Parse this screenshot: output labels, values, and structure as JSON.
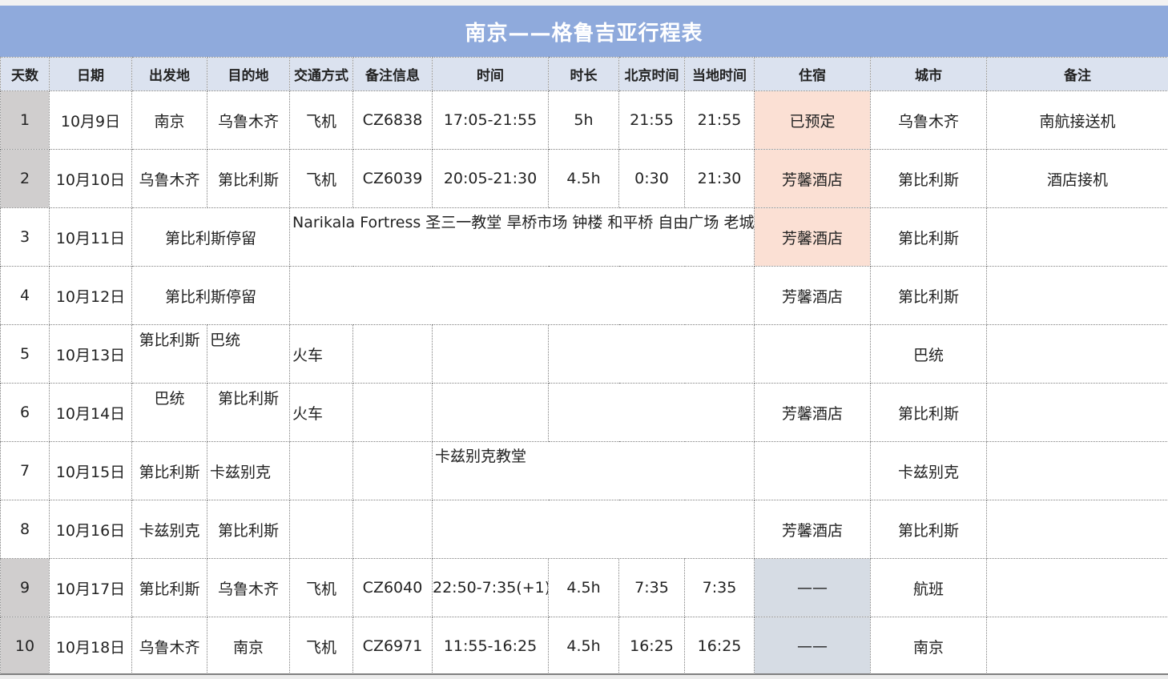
{
  "title": "南京——格鲁吉亚行程表",
  "headers": [
    "天数",
    "日期",
    "出发地",
    "目的地",
    "交通方式",
    "备注信息",
    "时间",
    "时长",
    "北京时间",
    "当地时间",
    "住宿",
    "城市",
    "备注"
  ],
  "rows": [
    {
      "day": "1",
      "date": "10月9日",
      "from": "南京",
      "to": "乌鲁木齐",
      "transport": "飞机",
      "info": "CZ6838",
      "time": "17:05-21:55",
      "duration": "5h",
      "beijing": "21:55",
      "local": "21:55",
      "hotel": "已预定",
      "city": "乌鲁木齐",
      "note": "南航接送机"
    },
    {
      "day": "2",
      "date": "10月10日",
      "from": "乌鲁木齐",
      "to": "第比利斯",
      "transport": "飞机",
      "info": "CZ6039",
      "time": "20:05-21:30",
      "duration": "4.5h",
      "beijing": "0:30",
      "local": "21:30",
      "hotel": "芳馨酒店",
      "city": "第比利斯",
      "note": "酒店接机"
    },
    {
      "day": "3",
      "date": "10月11日",
      "stay": "第比利斯停留",
      "activity": "Narikala Fortress 圣三一教堂 旱桥市场 钟楼 和平桥 自由广场 老城",
      "hotel": "芳馨酒店",
      "city": "第比利斯",
      "note": ""
    },
    {
      "day": "4",
      "date": "10月12日",
      "stay": "第比利斯停留",
      "activity": "",
      "hotel": "芳馨酒店",
      "city": "第比利斯",
      "note": ""
    },
    {
      "day": "5",
      "date": "10月13日",
      "from": "第比利斯",
      "to": "巴统",
      "transport": "火车",
      "info": "",
      "time": "",
      "duration": "",
      "beijing": "",
      "local": "",
      "hotel": "",
      "city": "巴统",
      "note": ""
    },
    {
      "day": "6",
      "date": "10月14日",
      "from": "巴统",
      "to": "第比利斯",
      "transport": "火车",
      "info": "",
      "time": "",
      "duration": "",
      "beijing": "",
      "local": "",
      "hotel": "芳馨酒店",
      "city": "第比利斯",
      "note": ""
    },
    {
      "day": "7",
      "date": "10月15日",
      "from": "第比利斯",
      "to": "卡兹别克",
      "transport": "",
      "info": "",
      "activity": "卡兹别克教堂",
      "hotel": "",
      "city": "卡兹别克",
      "note": ""
    },
    {
      "day": "8",
      "date": "10月16日",
      "from": "卡兹别克",
      "to": "第比利斯",
      "transport": "",
      "info": "",
      "activity": "",
      "hotel": "芳馨酒店",
      "city": "第比利斯",
      "note": ""
    },
    {
      "day": "9",
      "date": "10月17日",
      "from": "第比利斯",
      "to": "乌鲁木齐",
      "transport": "飞机",
      "info": "CZ6040",
      "time": "22:50-7:35(+1)",
      "duration": "4.5h",
      "beijing": "7:35",
      "local": "7:35",
      "hotel": "——",
      "city": "航班",
      "note": ""
    },
    {
      "day": "10",
      "date": "10月18日",
      "from": "乌鲁木齐",
      "to": "南京",
      "transport": "飞机",
      "info": "CZ6971",
      "time": "11:55-16:25",
      "duration": "4.5h",
      "beijing": "16:25",
      "local": "16:25",
      "hotel": "——",
      "city": "南京",
      "note": ""
    }
  ]
}
